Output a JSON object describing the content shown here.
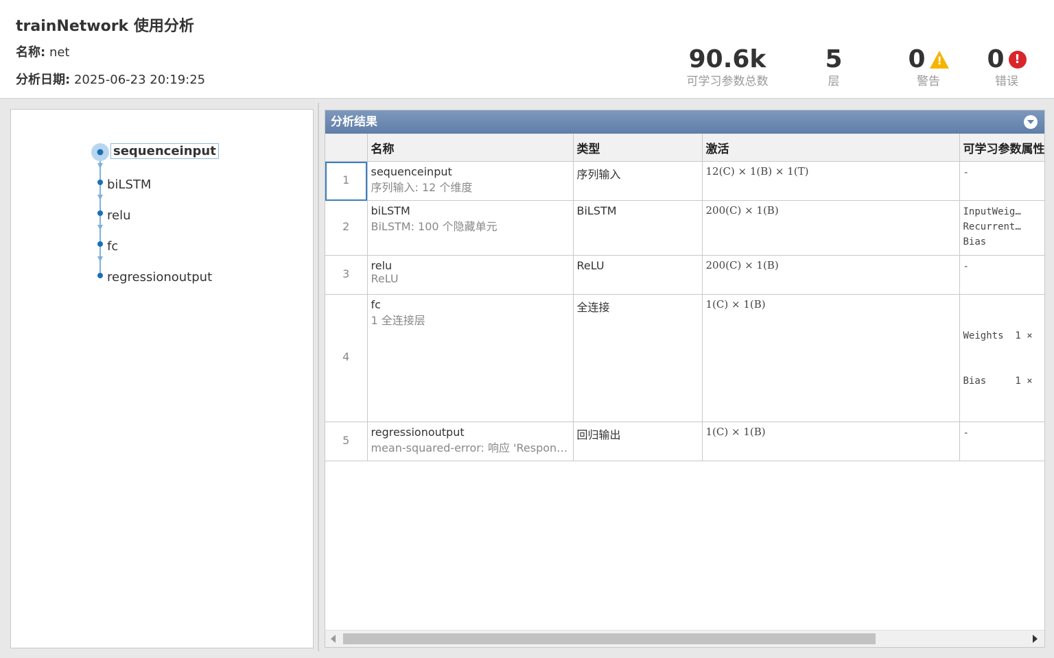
{
  "header": {
    "title": "trainNetwork 使用分析",
    "name_label": "名称:",
    "name_value": "net",
    "date_label": "分析日期:",
    "date_value": "2025-06-23 20:19:25"
  },
  "stats": {
    "params": {
      "value": "90.6k",
      "label": "可学习参数总数"
    },
    "layers": {
      "value": "5",
      "label": "层"
    },
    "warnings": {
      "value": "0",
      "label": "警告",
      "icon": "warning-icon",
      "color": "#f5b400"
    },
    "errors": {
      "value": "0",
      "label": "错误",
      "icon": "error-icon",
      "color": "#d9262a"
    }
  },
  "graph": {
    "nodes": [
      "sequenceinput",
      "biLSTM",
      "relu",
      "fc",
      "regressionoutput"
    ],
    "selected": "sequenceinput",
    "node_color": "#1a6fb5"
  },
  "results": {
    "title": "分析结果",
    "columns": [
      "",
      "名称",
      "类型",
      "激活",
      "可学习参数属性"
    ],
    "rows": [
      {
        "idx": "1",
        "name": "sequenceinput",
        "desc": "序列输入: 12 个维度",
        "type": "序列输入",
        "act": "12(C) × 1(B) × 1(T)",
        "params": [
          "-"
        ]
      },
      {
        "idx": "2",
        "name": "biLSTM",
        "desc": "BiLSTM: 100 个隐藏单元",
        "type": "BiLSTM",
        "act": "200(C) × 1(B)",
        "params": [
          "InputWeig…",
          "Recurrent…",
          "Bias"
        ]
      },
      {
        "idx": "3",
        "name": "relu",
        "desc": "ReLU",
        "type": "ReLU",
        "act": "200(C) × 1(B)",
        "params": [
          "-"
        ]
      },
      {
        "idx": "4",
        "name": "fc",
        "desc": "1 全连接层",
        "type": "全连接",
        "act": "1(C) × 1(B)",
        "params": [
          "Weights  1 ×",
          "Bias     1 ×"
        ]
      },
      {
        "idx": "5",
        "name": "regressionoutput",
        "desc": "mean-squared-error: 响应 'Respon…",
        "type": "回归输出",
        "act": "1(C) × 1(B)",
        "params": [
          "-"
        ]
      }
    ]
  }
}
